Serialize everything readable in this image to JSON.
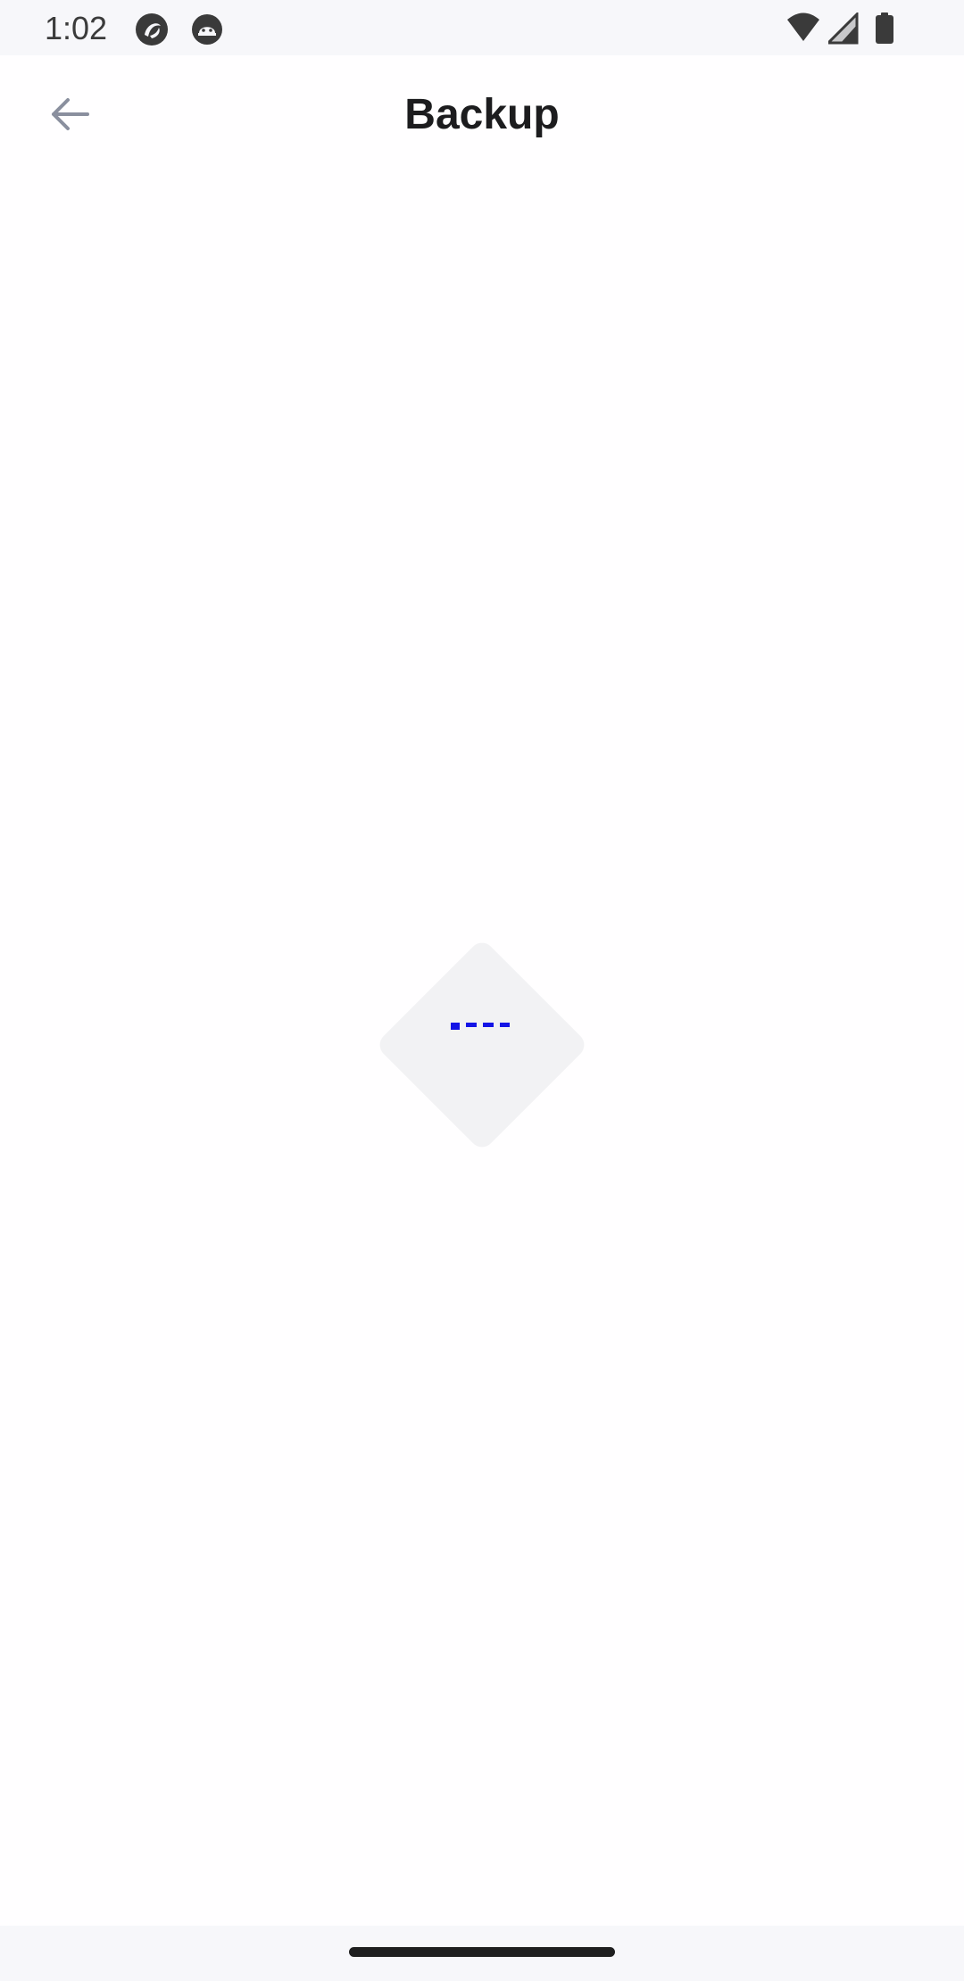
{
  "status_bar": {
    "time": "1:02",
    "left_icons": [
      "app-notification-icon",
      "robot-face-icon"
    ],
    "right_icons": [
      "wifi-icon",
      "cellular-signal-icon",
      "battery-icon"
    ]
  },
  "app_bar": {
    "title": "Backup",
    "back_icon": "arrow-back-icon"
  },
  "content": {
    "state": "loading",
    "loader_icon": "loading-diamond-icon"
  },
  "colors": {
    "status_bar_bg": "#F7F7FA",
    "page_bg": "#FFFEFF",
    "title": "#1C1C1E",
    "back_icon": "#8A8F9E",
    "loader_bg": "#F2F2F4",
    "loader_dots": "#1414E6"
  }
}
